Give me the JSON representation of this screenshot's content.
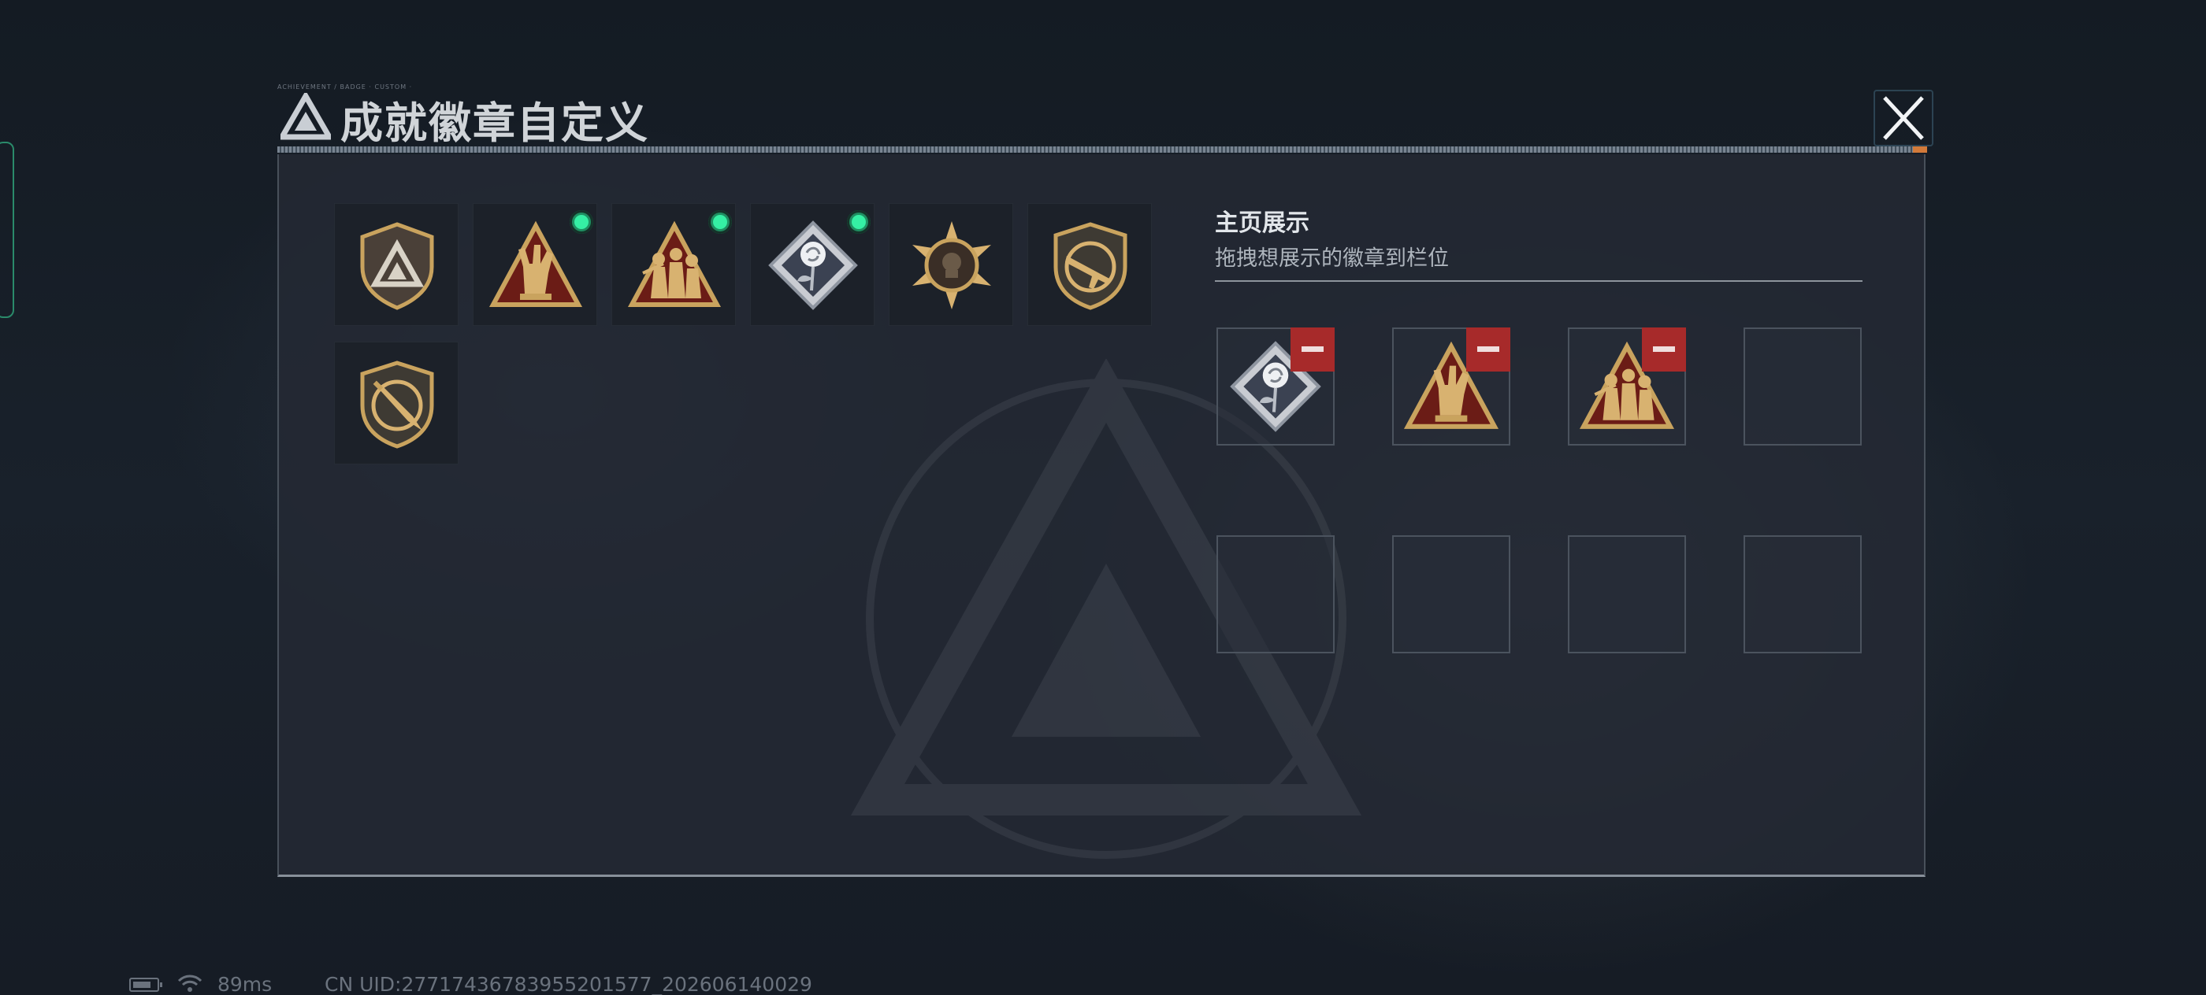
{
  "dialog": {
    "title": "成就徽章自定义",
    "title_tinytext": "ACHIEVEMENT / BADGE · CUSTOM ·",
    "close_icon": "close-icon"
  },
  "badge_collection": {
    "items": [
      {
        "name": "shield-triangle-badge",
        "equipped": false
      },
      {
        "name": "hand-sign-triangle-badge",
        "equipped": true
      },
      {
        "name": "soldiers-triangle-badge",
        "equipped": true
      },
      {
        "name": "rose-diamond-badge",
        "equipped": true
      },
      {
        "name": "star-circle-badge",
        "equipped": false
      },
      {
        "name": "rifle-shield-badge",
        "equipped": false
      },
      {
        "name": "knife-shield-badge",
        "equipped": false
      }
    ],
    "equipped_indicator_color": "#35f0a4"
  },
  "showcase": {
    "title": "主页展示",
    "hint": "拖拽想展示的徽章到栏位",
    "slots": [
      {
        "badge": "rose-diamond-badge",
        "filled": true
      },
      {
        "badge": "hand-sign-triangle-badge",
        "filled": true
      },
      {
        "badge": "soldiers-triangle-badge",
        "filled": true
      },
      {
        "badge": "",
        "filled": false
      },
      {
        "badge": "",
        "filled": false
      },
      {
        "badge": "",
        "filled": false
      },
      {
        "badge": "",
        "filled": false
      },
      {
        "badge": "",
        "filled": false
      }
    ],
    "remove_button_color": "#a72a2a"
  },
  "status_bar": {
    "ping": "89ms",
    "uid": "CN UID:27717436783955201577_202606140029"
  },
  "colors": {
    "gold": "#c9a35e",
    "dark_red": "#6b1c16",
    "panel_bg": "#242a34",
    "accent_orange": "#d27a3a"
  }
}
